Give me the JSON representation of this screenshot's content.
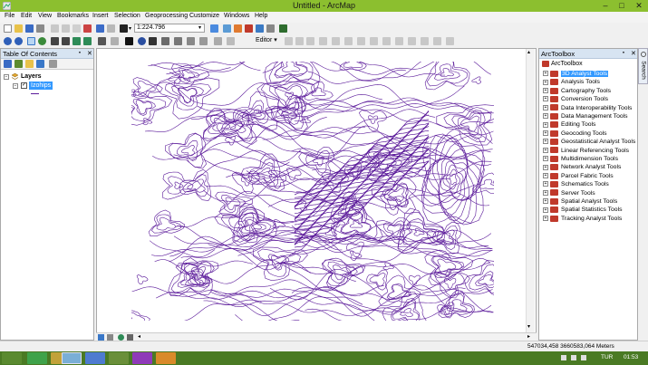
{
  "window": {
    "title": "Untitled - ArcMap",
    "minimize": "–",
    "maximize": "□",
    "close": "✕"
  },
  "menu": [
    "File",
    "Edit",
    "View",
    "Bookmarks",
    "Insert",
    "Selection",
    "Geoprocessing",
    "Customize",
    "Windows",
    "Help"
  ],
  "toolbar": {
    "scale": "1:224.796",
    "editor_label": "Editor ▾"
  },
  "toc": {
    "title": "Table Of Contents",
    "pin": "⬝",
    "close": "✕",
    "group": "Layers",
    "layer": "Izohips"
  },
  "toolbox": {
    "title": "ArcToolbox",
    "root": "ArcToolbox",
    "pin": "⬝",
    "close": "✕",
    "search_tab": "Search",
    "items": [
      {
        "label": "3D Analyst Tools",
        "selected": true
      },
      {
        "label": "Analysis Tools",
        "selected": false
      },
      {
        "label": "Cartography Tools",
        "selected": false
      },
      {
        "label": "Conversion Tools",
        "selected": false
      },
      {
        "label": "Data Interoperability Tools",
        "selected": false
      },
      {
        "label": "Data Management Tools",
        "selected": false
      },
      {
        "label": "Editing Tools",
        "selected": false
      },
      {
        "label": "Geocoding Tools",
        "selected": false
      },
      {
        "label": "Geostatistical Analyst Tools",
        "selected": false
      },
      {
        "label": "Linear Referencing Tools",
        "selected": false
      },
      {
        "label": "Multidimension Tools",
        "selected": false
      },
      {
        "label": "Network Analyst Tools",
        "selected": false
      },
      {
        "label": "Parcel Fabric Tools",
        "selected": false
      },
      {
        "label": "Schematics Tools",
        "selected": false
      },
      {
        "label": "Server Tools",
        "selected": false
      },
      {
        "label": "Spatial Analyst Tools",
        "selected": false
      },
      {
        "label": "Spatial Statistics Tools",
        "selected": false
      },
      {
        "label": "Tracking Analyst Tools",
        "selected": false
      }
    ]
  },
  "status": {
    "coords": "547034,458  3660583,064 Meters"
  },
  "taskbar": {
    "lang": "TUR",
    "time": "01:53"
  },
  "colors": {
    "titlebar": "#8cbf2f",
    "contour": "#5b1a9a",
    "selection": "#3399ff",
    "taskbar": "#4a7a24"
  }
}
